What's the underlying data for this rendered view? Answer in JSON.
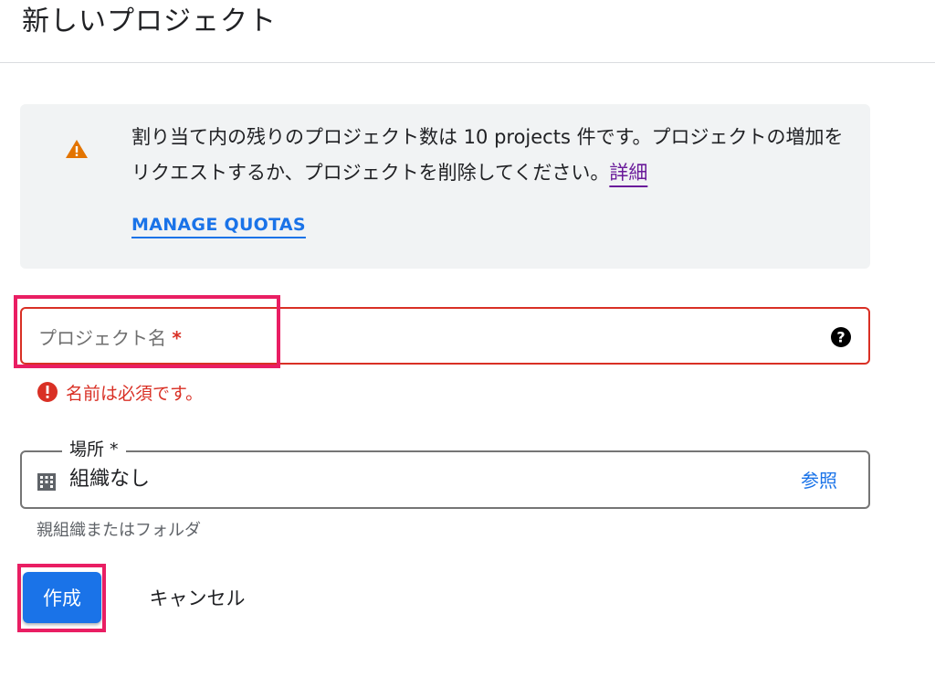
{
  "header": {
    "title": "新しいプロジェクト"
  },
  "quota_notice": {
    "icon": "warning-icon",
    "text": "割り当て内の残りのプロジェクト数は 10 projects 件です。プロジェクトの増加をリクエストするか、プロジェクトを削除してください。",
    "detail_link": "詳細",
    "manage_link": "MANAGE QUOTAS",
    "colors": {
      "background": "#f1f3f4",
      "warning": "#e37400",
      "link": "#1a73e8",
      "visited_link": "#6a1b9a"
    }
  },
  "project_name": {
    "label": "プロジェクト名",
    "required_marker": "*",
    "value": "",
    "help_icon": "help-circle-icon",
    "error_icon": "error-circle-icon",
    "error": "名前は必須です。",
    "error_color": "#d93025"
  },
  "location": {
    "label": "場所 *",
    "icon": "building-icon",
    "value": "組織なし",
    "browse": "参照",
    "hint": "親組織またはフォルダ"
  },
  "actions": {
    "create": "作成",
    "cancel": "キャンセル",
    "primary_color": "#1a73e8",
    "highlight_color": "#e91e63"
  }
}
